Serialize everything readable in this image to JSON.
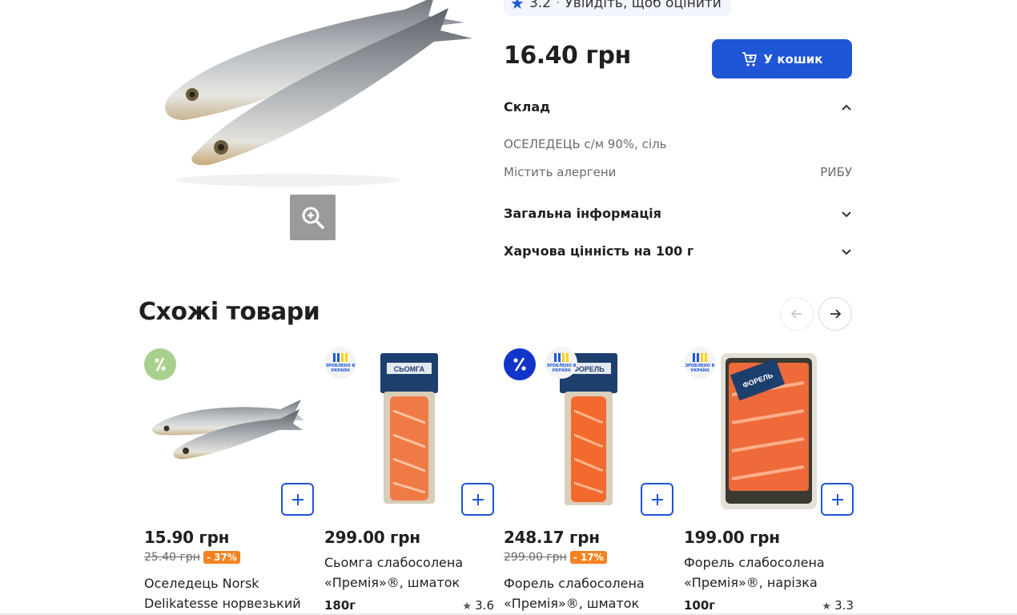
{
  "product": {
    "rating": "3.2",
    "rating_cta": "Увійдіть, щоб оцінити",
    "price": "16.40 грн",
    "cart_label": "У кошик",
    "sections": {
      "composition_title": "Склад",
      "composition_text": "ОСЕЛЕДЕЦЬ с/м 90%, сіль",
      "allergen_label": "Містить алергени",
      "allergen_value": "РИБУ",
      "general_title": "Загальна інформація",
      "nutrition_title": "Харчова цінність на 100 г"
    }
  },
  "similar": {
    "title": "Схожі товари",
    "items": [
      {
        "price": "15.90 грн",
        "old_price": "25.40 грн",
        "discount": "- 37%",
        "name_line1": "Оселедець Norsk",
        "name_line2": "Delikatesse норвезький",
        "badge": "promo-green"
      },
      {
        "price": "299.00 грн",
        "name_line1": "Сьомга слабосолена",
        "name_line2": "«Премія»®, шматок",
        "weight": "180г",
        "rating": "3.6",
        "badge": "made-in-ukraine",
        "pack_label": "СЬОМГА"
      },
      {
        "price": "248.17 грн",
        "old_price": "299.00 грн",
        "discount": "- 17%",
        "name_line1": "Форель слабосолена",
        "name_line2": "«Премія»®, шматок",
        "badge": "promo-blue",
        "pack_label": "ФОРЕЛЬ"
      },
      {
        "price": "199.00 грн",
        "name_line1": "Форель слабосолена",
        "name_line2": "«Премія»®, нарізка",
        "weight": "100г",
        "rating": "3.3",
        "badge": "made-in-ukraine",
        "pack_label": "ФОРЕЛЬ"
      }
    ],
    "made_in_ua_text": "ЗРОБЛЕНО В УКРАЇНІ"
  },
  "colors": {
    "accent": "#1e56d6",
    "discount": "#f58220",
    "promo_green": "#a8d08d"
  }
}
